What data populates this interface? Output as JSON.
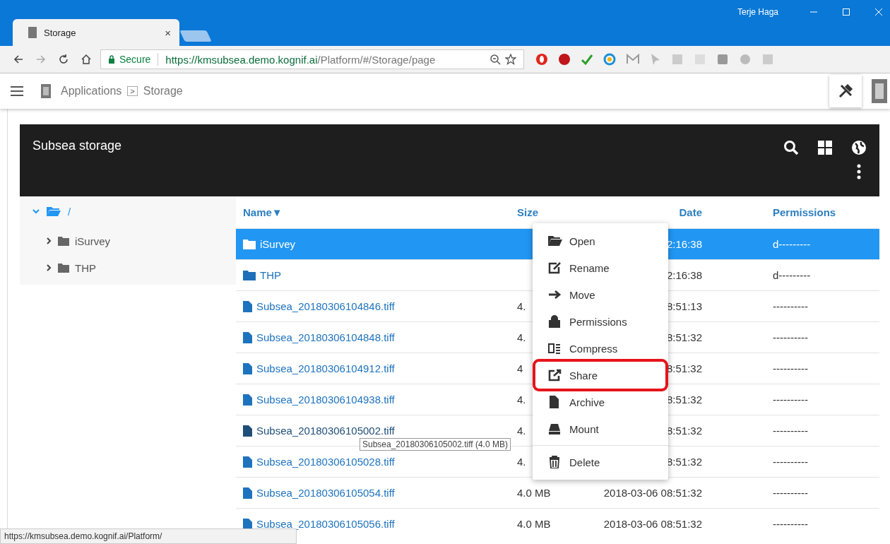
{
  "browser": {
    "tab_title": "Storage",
    "tab_close": "×",
    "user": "Terje Haga",
    "secure_label": "Secure",
    "url_host": "https://kmsubsea.demo.kognif.ai",
    "url_path": "/Platform/#/Storage/page"
  },
  "app_bar": {
    "breadcrumb": [
      "Applications",
      "Storage"
    ],
    "separator": ">"
  },
  "panel": {
    "title": "Subsea storage"
  },
  "tree": [
    {
      "label": "/",
      "expanded": true,
      "children": [
        {
          "label": "iSurvey",
          "expanded": false
        },
        {
          "label": "THP",
          "expanded": false
        }
      ]
    }
  ],
  "table": {
    "columns": [
      {
        "label": "Name",
        "sort": "▼"
      },
      {
        "label": "Size"
      },
      {
        "label": "Date"
      },
      {
        "label": "Permissions"
      }
    ],
    "rows": [
      {
        "kind": "folder",
        "name": "iSurvey",
        "date": "2:16:38",
        "permissions": "d---------",
        "selected": true,
        "hovered": false
      },
      {
        "kind": "folder",
        "name": "THP",
        "date": "2:16:38",
        "permissions": "d---------",
        "selected": false,
        "hovered": false
      },
      {
        "kind": "file",
        "name": "Subsea_20180306104846.tiff",
        "size": "4.",
        "date": "8:51:13",
        "permissions": "----------",
        "selected": false,
        "hovered": false
      },
      {
        "kind": "file",
        "name": "Subsea_20180306104848.tiff",
        "size": "4.",
        "date": "8:51:32",
        "permissions": "----------",
        "selected": false,
        "hovered": false
      },
      {
        "kind": "file",
        "name": "Subsea_20180306104912.tiff",
        "size": "4",
        "date": "8:51:32",
        "permissions": "----------",
        "selected": false,
        "hovered": false
      },
      {
        "kind": "file",
        "name": "Subsea_20180306104938.tiff",
        "size": "4.",
        "date": "8:51:32",
        "permissions": "----------",
        "selected": false,
        "hovered": false
      },
      {
        "kind": "file",
        "name": "Subsea_20180306105002.tiff",
        "size": "4.",
        "date": "8:51:32",
        "permissions": "----------",
        "selected": false,
        "hovered": true
      },
      {
        "kind": "file",
        "name": "Subsea_20180306105028.tiff",
        "size": "4.",
        "date": "8:51:32",
        "permissions": "----------",
        "selected": false,
        "hovered": false
      },
      {
        "kind": "file",
        "name": "Subsea_20180306105054.tiff",
        "size": "4.0 MB",
        "date": "2018-03-06 08:51:32",
        "permissions": "----------",
        "selected": false,
        "hovered": false
      },
      {
        "kind": "file",
        "name": "Subsea_20180306105056.tiff",
        "size": "4.0 MB",
        "date": "2018-03-06 08:51:32",
        "permissions": "----------",
        "selected": false,
        "hovered": false
      }
    ]
  },
  "context_menu": [
    {
      "label": "Open",
      "highlighted": false
    },
    {
      "label": "Rename",
      "highlighted": false
    },
    {
      "label": "Move",
      "highlighted": false
    },
    {
      "label": "Permissions",
      "highlighted": false
    },
    {
      "label": "Compress",
      "highlighted": false
    },
    {
      "label": "Share",
      "highlighted": true
    },
    {
      "label": "Archive",
      "highlighted": false
    },
    {
      "label": "Mount",
      "highlighted": false
    },
    {
      "label": "Delete",
      "highlighted": false,
      "divider_before": true
    }
  ],
  "tooltip": "Subsea_20180306105002.tiff (4.0  MB)",
  "status_bar": "https://kmsubsea.demo.kognif.ai/Platform/"
}
